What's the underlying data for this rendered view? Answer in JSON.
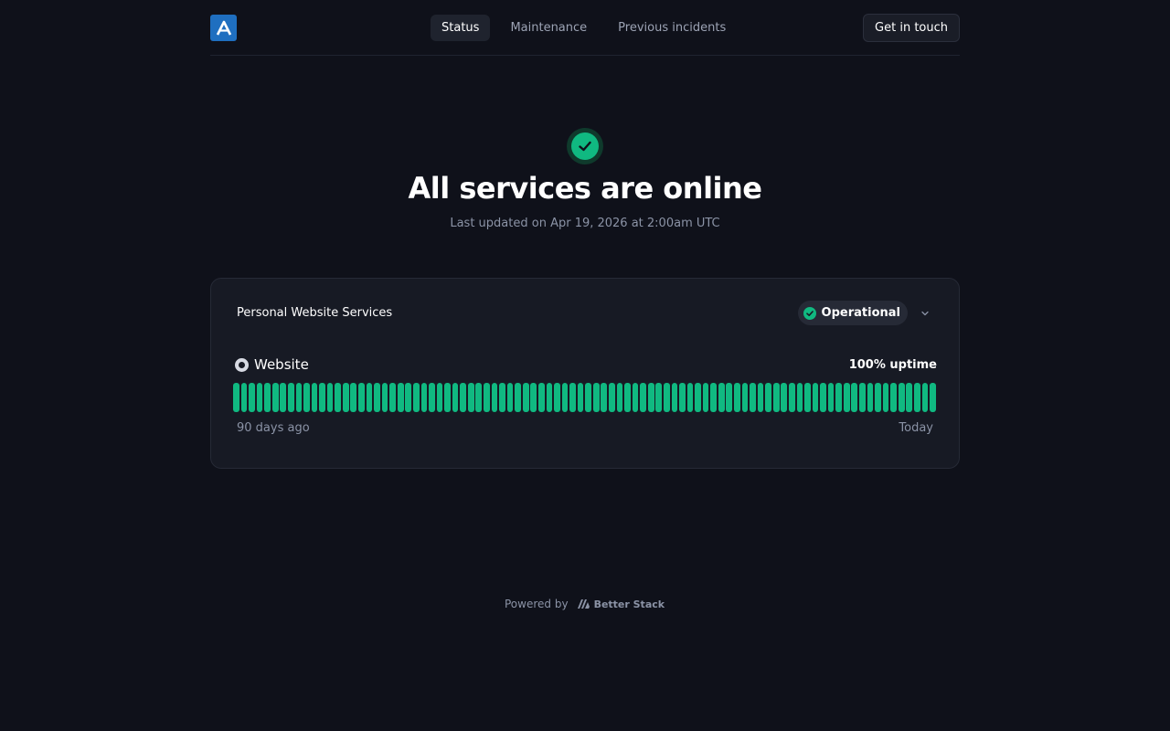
{
  "header": {
    "logo_icon": "letter-a-logo-icon",
    "tabs": [
      {
        "label": "Status",
        "active": true
      },
      {
        "label": "Maintenance",
        "active": false
      },
      {
        "label": "Previous incidents",
        "active": false
      }
    ],
    "contact_label": "Get in touch"
  },
  "hero": {
    "icon": "check-circle-icon",
    "title": "All services are online",
    "subtitle": "Last updated on Apr 19, 2026 at 2:00am UTC"
  },
  "group": {
    "title": "Personal Website Services",
    "status_label": "Operational",
    "status_color": "#10b981",
    "expand_icon": "chevron-down-icon",
    "services": [
      {
        "name": "Website",
        "uptime_label": "100% uptime",
        "days": 90,
        "bar_color": "#10b981",
        "range_start": "90 days ago",
        "range_end": "Today"
      }
    ]
  },
  "footer": {
    "powered_by": "Powered by",
    "brand": "Better Stack",
    "brand_icon": "betterstack-logo-icon"
  },
  "colors": {
    "background": "#0f111a",
    "card": "#171a24",
    "accent": "#10b981",
    "logo": "#1f6fc0"
  }
}
